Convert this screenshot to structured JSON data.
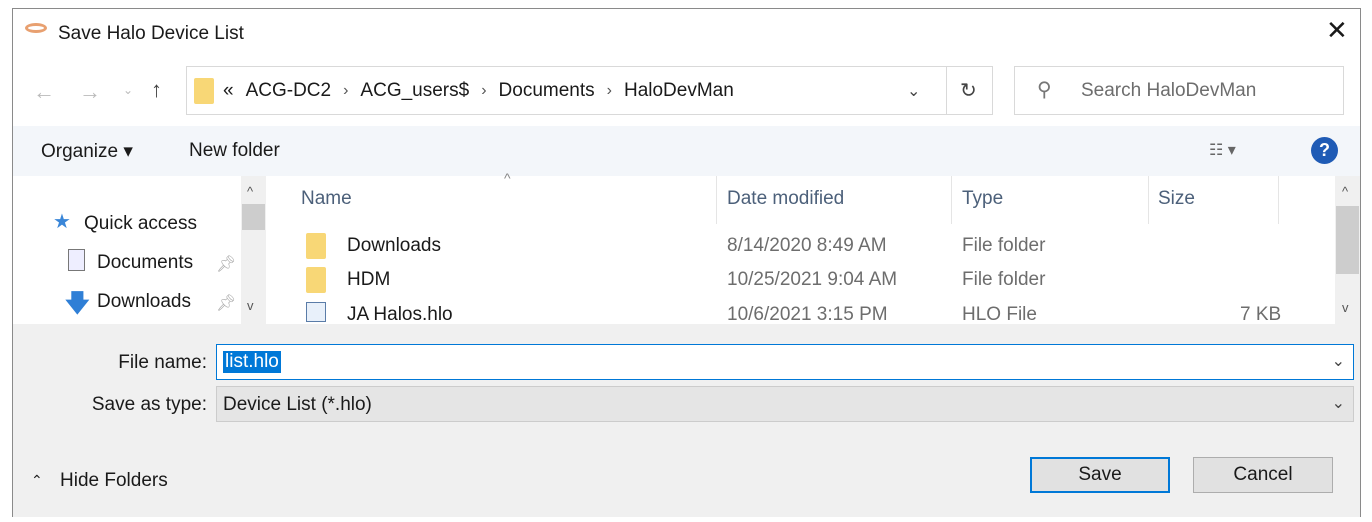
{
  "title": "Save Halo Device List",
  "nav": {
    "path": [
      "ACG-DC2",
      "ACG_users$",
      "Documents",
      "HaloDevMan"
    ],
    "overflow": "«",
    "search_placeholder": "Search HaloDevMan"
  },
  "toolbar": {
    "organize": "Organize ▾",
    "new_folder": "New folder"
  },
  "sidebar": {
    "items": [
      {
        "label": "Quick access"
      },
      {
        "label": "Documents"
      },
      {
        "label": "Downloads"
      }
    ]
  },
  "columns": [
    "Name",
    "Date modified",
    "Type",
    "Size"
  ],
  "files": [
    {
      "name": "Downloads",
      "date": "8/14/2020 8:49 AM",
      "type": "File folder",
      "size": "",
      "icon": "folder"
    },
    {
      "name": "HDM",
      "date": "10/25/2021 9:04 AM",
      "type": "File folder",
      "size": "",
      "icon": "folder"
    },
    {
      "name": "JA Halos.hlo",
      "date": "10/6/2021 3:15 PM",
      "type": "HLO File",
      "size": "7 KB",
      "icon": "file"
    }
  ],
  "form": {
    "file_name_label": "File name:",
    "file_name": "list.hlo",
    "type_label": "Save as type:",
    "type_value": "Device List (*.hlo)"
  },
  "buttons": {
    "hide_folders": "Hide Folders",
    "save": "Save",
    "cancel": "Cancel"
  }
}
